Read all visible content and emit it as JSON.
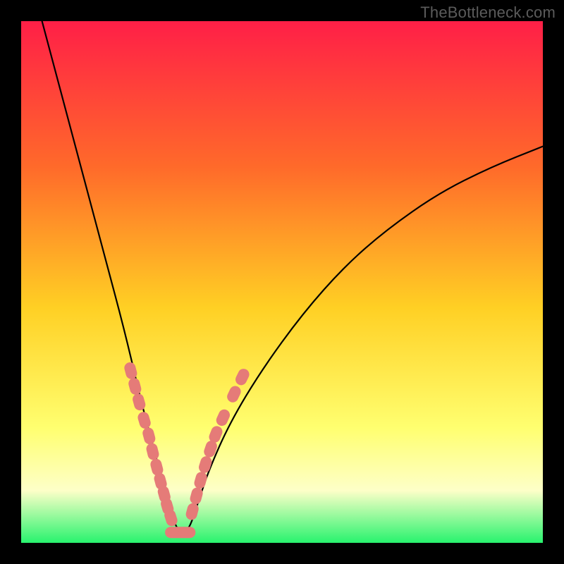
{
  "watermark": "TheBottleneck.com",
  "colors": {
    "frame": "#000000",
    "gradient_top": "#ff1f47",
    "gradient_mid1": "#ff6a2a",
    "gradient_mid2": "#ffd024",
    "gradient_mid3": "#ffff70",
    "gradient_band": "#fdffc8",
    "gradient_bottom": "#28f36e",
    "curve": "#000000",
    "marker_fill": "#e57b78",
    "marker_stroke": "#c9605d"
  },
  "chart_data": {
    "type": "line",
    "title": "",
    "xlabel": "",
    "ylabel": "",
    "xlim": [
      0,
      100
    ],
    "ylim": [
      0,
      100
    ],
    "note": "Featureless axes (no ticks/labels shown). Single black V-shaped bottleneck curve on a red→green vertical gradient. Pink capsule markers clustered near the trough on both arms.",
    "curve": {
      "comment": "Bottleneck curve. Left arm drops steeply to a minimum near x≈30, right arm rises more gently. y is percent-of-height from bottom.",
      "x": [
        4,
        8,
        12,
        16,
        20,
        23,
        26,
        28,
        30,
        32,
        34,
        36,
        40,
        46,
        54,
        62,
        70,
        80,
        90,
        100
      ],
      "y": [
        100,
        85,
        70,
        55,
        40,
        27,
        16,
        8,
        2,
        2,
        8,
        14,
        23,
        33,
        44,
        53,
        60,
        67,
        72,
        76
      ]
    },
    "left_arm_markers": {
      "comment": "Capsule markers on the left descending arm, clustered in the lower ~30% of height.",
      "points": [
        {
          "x": 21.0,
          "y": 33.0
        },
        {
          "x": 21.8,
          "y": 30.0
        },
        {
          "x": 22.6,
          "y": 27.0
        },
        {
          "x": 23.6,
          "y": 23.5
        },
        {
          "x": 24.5,
          "y": 20.5
        },
        {
          "x": 25.2,
          "y": 17.5
        },
        {
          "x": 26.0,
          "y": 14.5
        },
        {
          "x": 26.7,
          "y": 11.8
        },
        {
          "x": 27.4,
          "y": 9.3
        },
        {
          "x": 28.0,
          "y": 7.0
        },
        {
          "x": 28.7,
          "y": 4.8
        }
      ]
    },
    "right_arm_markers": {
      "comment": "Capsule markers on the right ascending arm, near the trough.",
      "points": [
        {
          "x": 32.8,
          "y": 6.0
        },
        {
          "x": 33.6,
          "y": 9.0
        },
        {
          "x": 34.4,
          "y": 12.0
        },
        {
          "x": 35.3,
          "y": 15.0
        },
        {
          "x": 36.3,
          "y": 18.0
        },
        {
          "x": 37.3,
          "y": 20.8
        },
        {
          "x": 38.7,
          "y": 24.0
        },
        {
          "x": 40.8,
          "y": 28.5
        },
        {
          "x": 42.4,
          "y": 31.8
        }
      ]
    },
    "bottom_markers": {
      "comment": "Horizontal capsules along the trough base.",
      "points": [
        {
          "x": 29.2,
          "y": 2.0
        },
        {
          "x": 30.5,
          "y": 2.0
        },
        {
          "x": 31.8,
          "y": 2.0
        }
      ]
    }
  }
}
